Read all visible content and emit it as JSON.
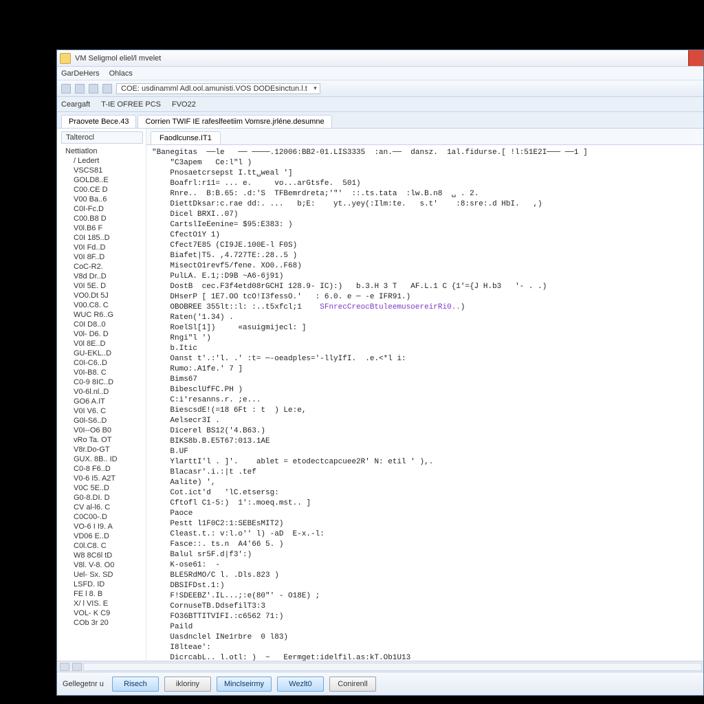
{
  "titlebar": {
    "title": "VM Seligmol eliel/l mvelet"
  },
  "menubar": {
    "items": [
      "GarDeHers",
      "Ohlacs"
    ]
  },
  "toolbar": {
    "path": "COE: usdinamml  Adl.ool.amunisti.VOS DODEsinctun.l.t"
  },
  "secondbar": {
    "items": [
      "Ceargaft",
      "T-IE OFREE PCS",
      "FVO22"
    ]
  },
  "tabs": [
    "Praovete Bece.43",
    "Corrien  TWIF   IE rafeslfeetiim Vomsre.jrléne.desumne"
  ],
  "sidebar": {
    "header": "Talterocl",
    "root": "Nettiatlon",
    "items": [
      "/ Ledert",
      "VSCS81",
      "GOLD8..E",
      "C00.CE D",
      "V00 Ba..6",
      "C0I-Fc.D",
      "C00.B8 D",
      "V0l.B6 F",
      "C0I 185..D",
      "V0I Fd..D",
      "V0I 8F..D",
      "CoC-R2.",
      "V8d Dr..D",
      "V0I 5E. D",
      "VO0.Dt 5J",
      "V00.C8. C",
      "WUC R6..G",
      "C0I D8..0",
      "V0l- D6. D",
      "V0l 8E..D",
      "GU-EKL..D",
      "C0I-C6..D",
      "V0I-B8. C",
      "C0-9 8IC..D",
      "V0-6l.nl..D",
      "GO6 A.IT",
      "V0I V6. C",
      "G0l-S6..D",
      "V0I--O6 B0",
      "vRo Ta. OT",
      "V8r.Do-GT",
      "GUX. 8B.. ID",
      "C0-8 F6..D",
      "V0-6 I5. A2T",
      "V0C 5E..D",
      "G0-8.DI. D",
      "CV al-l6. C",
      "C0C00-.D",
      "VO-6 I I9. A",
      "VD06 E..D",
      "C0l.C8. C",
      "W8 8C6l tD",
      "V8l. V-8. O0",
      "Uel- Sx. SD",
      "LSFD. ID",
      "FE l 8. B",
      "X/ l VIS. E",
      "VOL- K  C9",
      "COb 3r  20"
    ]
  },
  "main": {
    "tab": "Faodlcunse.IT1",
    "lines": [
      {
        "t": "\"Banegitas  ──le   ── ────.12006:BB2-01.LIS3335  :an.──  dansz.  1al.fidurse.[ !l:51E2I─── ──1 ]"
      },
      {
        "t": "    \"C3apem   Ce:l\"l )"
      },
      {
        "t": "    Pnosaetcrsepst I.tt␣weal ']"
      },
      {
        "t": "    Boafrl:r11= ... e.     vo...arGtsfe.  501)"
      },
      {
        "t": "    Rnre..  B:B.65: .d:'S  TFBemrdreta;'\"'  ::.ts.tata  :lw.B.n8  ␣ . 2."
      },
      {
        "t": "    DiettDksar:c.rae dd:. ...   b;E:    yt..yey(:Ilm:te.   s.t'    :8:sre:.d HbI.   ,)"
      },
      {
        "t": "    Dicel BRXI..07)"
      },
      {
        "t": "    CartslIeEenine= $95:E383: )"
      },
      {
        "t": "    CfectO1Y 1)"
      },
      {
        "t": "    Cfect7E85 (CI9JE.100E-l F0S)"
      },
      {
        "t": "    Biafet|T5. ,4.727TE:.28..5 )"
      },
      {
        "t": "    MisectO1revf5/fene. XO0..F68)"
      },
      {
        "t": "    PulLA. E.1;:D9B ~A6-6j91)"
      },
      {
        "t": "    DostB  cec.F3f4etd08rGCHI 128.9- IC):)   b.3.H 3 T   AF.L.1 C {1'={J H.b3   '- . .)"
      },
      {
        "t": "    DHserP [ 1E7.OO tcO!I3fessO.'   : 6.0. e ─ -e IFR91.)"
      },
      {
        "t": "    OBOBREE 355lt::l: :..t5xfcl;1    ",
        "hl": "SFnrecCreocBtuleemusoereirRi0..",
        "t2": ")"
      },
      {
        "t": "    Raten('1.34) ."
      },
      {
        "t": "    RoelSl[1])     «asuigmijecl: ]"
      },
      {
        "t": "    Rngi\"l ')"
      },
      {
        "t": "    b.Itic"
      },
      {
        "t": "    Oanst t'.:'l. .' :t= ─-oeadples='-llyIfI.  .e.<*l i:"
      },
      {
        "t": "    Rumo:.A1fe.' 7 ]"
      },
      {
        "t": "    Bims67"
      },
      {
        "t": "    BibesclUfFC.PH )"
      },
      {
        "t": "    C:i'resanns.r. ;e..."
      },
      {
        "t": "    BiescsdE!(=18 6Ft : t  ) Le:e,"
      },
      {
        "t": "    Aelsecr3I ."
      },
      {
        "t": "    Dicerel BS12('4.B63.)"
      },
      {
        "t": "    BIKS8b.B.E5T67:013.1AE"
      },
      {
        "t": "    B.UF"
      },
      {
        "t": "    YlarttI'l . ]'.    ablet = etodectcapcuee2R' N: etil ' ),."
      },
      {
        "t": "    Blacasr'.i.:|t .tef"
      },
      {
        "t": "    Aalite) ',"
      },
      {
        "t": "    Cot.ict'd   'lC.etsersg:"
      },
      {
        "t": "    Cftofl C1-5:)  1':.moeq.mst.. ]"
      },
      {
        "t": "    Paoce"
      },
      {
        "t": "    Pestt l1F0C2:1:SEBEsMIT2)"
      },
      {
        "t": "    Cleast.t.: v:l.o'' l) -aD  E-x.-l:"
      },
      {
        "t": "    Fasce:️:. ts.n  A4'66 5. )"
      },
      {
        "t": "    Balul sr5F.d|f3':)"
      },
      {
        "t": "    K-ose61:  -"
      },
      {
        "t": "    BLE5RdMO/C l. .Dls.823 )"
      },
      {
        "t": "    DBSIFDst.1:)"
      },
      {
        "t": "    F!SDEEBZ'.IL...;:e(80\"' - O18E) ;"
      },
      {
        "t": "    CornuseTB.DdsefilT3:3"
      },
      {
        "t": "    FO36BTTITVIFI.:c6562 71:)"
      },
      {
        "t": "    Paild"
      },
      {
        "t": "    Uasdnclel INe1rbre  0 l83)"
      },
      {
        "t": "    I8lteae':"
      },
      {
        "t": "    DicrcabL.. l.otl: )  ~   Eermget:idelfil.as:kT.Ob1U13"
      }
    ]
  },
  "footer": {
    "label": "Gellegetnr u",
    "buttons": [
      {
        "label": "Risech",
        "style": "blue"
      },
      {
        "label": "ikloriny",
        "style": "grey"
      },
      {
        "label": "Minclseirmy",
        "style": "blue"
      },
      {
        "label": "Wezlt0",
        "style": "blue"
      },
      {
        "label": "Conirenll",
        "style": "grey"
      }
    ]
  }
}
